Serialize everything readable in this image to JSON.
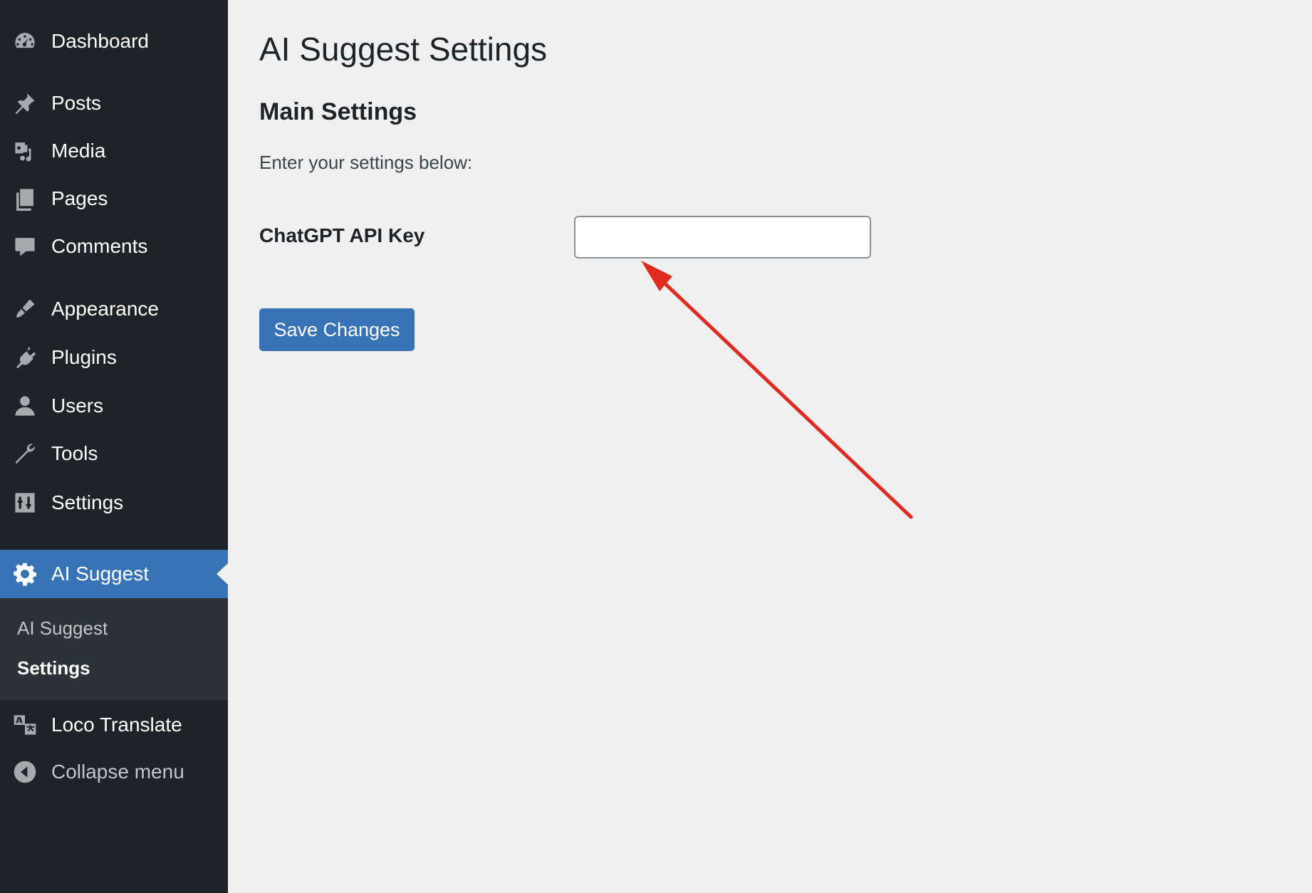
{
  "sidebar": {
    "items": [
      {
        "label": "Dashboard",
        "icon": "dashboard-icon"
      },
      {
        "label": "Posts",
        "icon": "pin-icon"
      },
      {
        "label": "Media",
        "icon": "media-icon"
      },
      {
        "label": "Pages",
        "icon": "pages-icon"
      },
      {
        "label": "Comments",
        "icon": "comment-icon"
      },
      {
        "label": "Appearance",
        "icon": "paintbrush-icon"
      },
      {
        "label": "Plugins",
        "icon": "plugin-icon"
      },
      {
        "label": "Users",
        "icon": "user-icon"
      },
      {
        "label": "Tools",
        "icon": "wrench-icon"
      },
      {
        "label": "Settings",
        "icon": "sliders-icon"
      },
      {
        "label": "AI Suggest",
        "icon": "gear-icon",
        "current": true
      },
      {
        "label": "Loco Translate",
        "icon": "translate-icon"
      },
      {
        "label": "Collapse menu",
        "icon": "collapse-arrow-icon"
      }
    ],
    "submenu": [
      {
        "label": "AI Suggest"
      },
      {
        "label": "Settings",
        "active": true
      }
    ]
  },
  "main": {
    "title": "AI Suggest Settings",
    "section_title": "Main Settings",
    "section_description": "Enter your settings below:",
    "field_label": "ChatGPT API Key",
    "field_value": "",
    "save_label": "Save Changes"
  },
  "colors": {
    "sidebar_bg": "#1d2327",
    "submenu_bg": "#2c3338",
    "accent": "#3873b5",
    "page_bg": "#f0f0f1",
    "annotation_arrow": "#e02b20"
  }
}
